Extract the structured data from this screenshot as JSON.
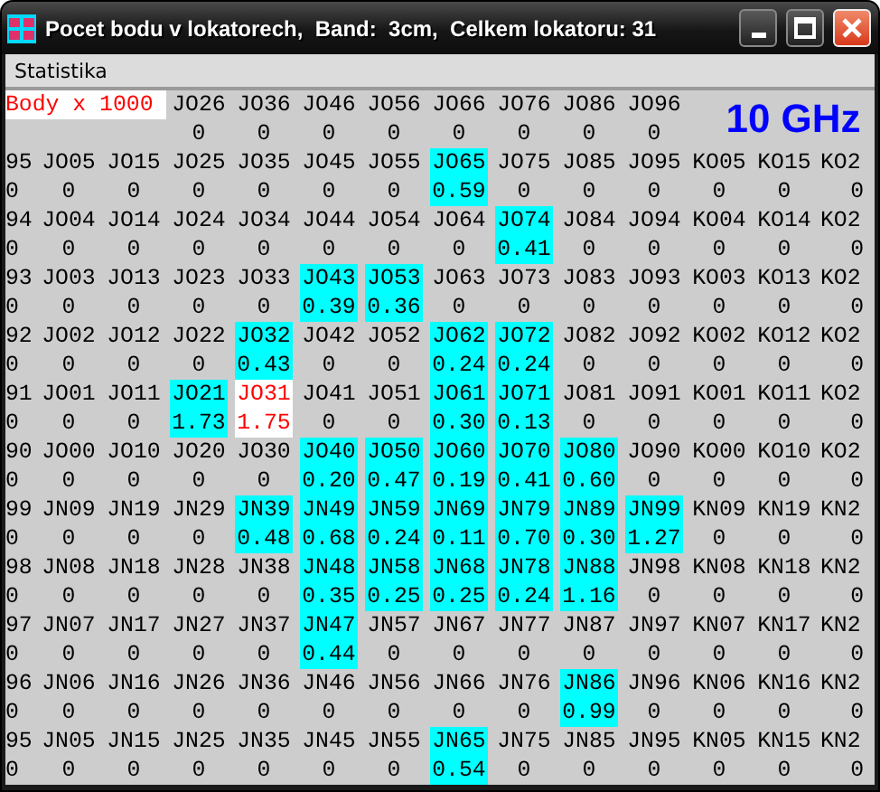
{
  "window": {
    "title": "Pocet bodu v lokatorech,  Band:  3cm,  Celkem lokatoru: 31"
  },
  "menu": [
    {
      "label": "Statistika"
    }
  ],
  "header": {
    "legend": "Body x 1000",
    "band_label": "10 GHz",
    "cells": [
      {
        "loc": "JO26",
        "pts": "0"
      },
      {
        "loc": "JO36",
        "pts": "0"
      },
      {
        "loc": "JO46",
        "pts": "0"
      },
      {
        "loc": "JO56",
        "pts": "0"
      },
      {
        "loc": "JO66",
        "pts": "0"
      },
      {
        "loc": "JO76",
        "pts": "0"
      },
      {
        "loc": "JO86",
        "pts": "0"
      },
      {
        "loc": "JO96",
        "pts": "0"
      }
    ]
  },
  "rows": [
    {
      "cells": [
        {
          "loc": "95",
          "pts": "0",
          "kind": "none"
        },
        {
          "loc": "JO05",
          "pts": "0",
          "kind": "none"
        },
        {
          "loc": "JO15",
          "pts": "0",
          "kind": "none"
        },
        {
          "loc": "JO25",
          "pts": "0",
          "kind": "none"
        },
        {
          "loc": "JO35",
          "pts": "0",
          "kind": "none"
        },
        {
          "loc": "JO45",
          "pts": "0",
          "kind": "none"
        },
        {
          "loc": "JO55",
          "pts": "0",
          "kind": "none"
        },
        {
          "loc": "JO65",
          "pts": "0.59",
          "kind": "worked"
        },
        {
          "loc": "JO75",
          "pts": "0",
          "kind": "none"
        },
        {
          "loc": "JO85",
          "pts": "0",
          "kind": "none"
        },
        {
          "loc": "JO95",
          "pts": "0",
          "kind": "none"
        },
        {
          "loc": "KO05",
          "pts": "0",
          "kind": "none"
        },
        {
          "loc": "KO15",
          "pts": "0",
          "kind": "none"
        },
        {
          "loc": "KO2",
          "pts": "0",
          "kind": "none"
        }
      ]
    },
    {
      "cells": [
        {
          "loc": "94",
          "pts": "0",
          "kind": "none"
        },
        {
          "loc": "JO04",
          "pts": "0",
          "kind": "none"
        },
        {
          "loc": "JO14",
          "pts": "0",
          "kind": "none"
        },
        {
          "loc": "JO24",
          "pts": "0",
          "kind": "none"
        },
        {
          "loc": "JO34",
          "pts": "0",
          "kind": "none"
        },
        {
          "loc": "JO44",
          "pts": "0",
          "kind": "none"
        },
        {
          "loc": "JO54",
          "pts": "0",
          "kind": "none"
        },
        {
          "loc": "JO64",
          "pts": "0",
          "kind": "none"
        },
        {
          "loc": "JO74",
          "pts": "0.41",
          "kind": "worked"
        },
        {
          "loc": "JO84",
          "pts": "0",
          "kind": "none"
        },
        {
          "loc": "JO94",
          "pts": "0",
          "kind": "none"
        },
        {
          "loc": "KO04",
          "pts": "0",
          "kind": "none"
        },
        {
          "loc": "KO14",
          "pts": "0",
          "kind": "none"
        },
        {
          "loc": "KO2",
          "pts": "0",
          "kind": "none"
        }
      ]
    },
    {
      "cells": [
        {
          "loc": "93",
          "pts": "0",
          "kind": "none"
        },
        {
          "loc": "JO03",
          "pts": "0",
          "kind": "none"
        },
        {
          "loc": "JO13",
          "pts": "0",
          "kind": "none"
        },
        {
          "loc": "JO23",
          "pts": "0",
          "kind": "none"
        },
        {
          "loc": "JO33",
          "pts": "0",
          "kind": "none"
        },
        {
          "loc": "JO43",
          "pts": "0.39",
          "kind": "worked"
        },
        {
          "loc": "JO53",
          "pts": "0.36",
          "kind": "worked"
        },
        {
          "loc": "JO63",
          "pts": "0",
          "kind": "none"
        },
        {
          "loc": "JO73",
          "pts": "0",
          "kind": "none"
        },
        {
          "loc": "JO83",
          "pts": "0",
          "kind": "none"
        },
        {
          "loc": "JO93",
          "pts": "0",
          "kind": "none"
        },
        {
          "loc": "KO03",
          "pts": "0",
          "kind": "none"
        },
        {
          "loc": "KO13",
          "pts": "0",
          "kind": "none"
        },
        {
          "loc": "KO2",
          "pts": "0",
          "kind": "none"
        }
      ]
    },
    {
      "cells": [
        {
          "loc": "92",
          "pts": "0",
          "kind": "none"
        },
        {
          "loc": "JO02",
          "pts": "0",
          "kind": "none"
        },
        {
          "loc": "JO12",
          "pts": "0",
          "kind": "none"
        },
        {
          "loc": "JO22",
          "pts": "0",
          "kind": "none"
        },
        {
          "loc": "JO32",
          "pts": "0.43",
          "kind": "worked"
        },
        {
          "loc": "JO42",
          "pts": "0",
          "kind": "none"
        },
        {
          "loc": "JO52",
          "pts": "0",
          "kind": "none"
        },
        {
          "loc": "JO62",
          "pts": "0.24",
          "kind": "worked"
        },
        {
          "loc": "JO72",
          "pts": "0.24",
          "kind": "worked"
        },
        {
          "loc": "JO82",
          "pts": "0",
          "kind": "none"
        },
        {
          "loc": "JO92",
          "pts": "0",
          "kind": "none"
        },
        {
          "loc": "KO02",
          "pts": "0",
          "kind": "none"
        },
        {
          "loc": "KO12",
          "pts": "0",
          "kind": "none"
        },
        {
          "loc": "KO2",
          "pts": "0",
          "kind": "none"
        }
      ]
    },
    {
      "cells": [
        {
          "loc": "91",
          "pts": "0",
          "kind": "none"
        },
        {
          "loc": "JO01",
          "pts": "0",
          "kind": "none"
        },
        {
          "loc": "JO11",
          "pts": "0",
          "kind": "none"
        },
        {
          "loc": "JO21",
          "pts": "1.73",
          "kind": "worked"
        },
        {
          "loc": "JO31",
          "pts": "1.75",
          "kind": "home"
        },
        {
          "loc": "JO41",
          "pts": "0",
          "kind": "none"
        },
        {
          "loc": "JO51",
          "pts": "0",
          "kind": "none"
        },
        {
          "loc": "JO61",
          "pts": "0.30",
          "kind": "worked"
        },
        {
          "loc": "JO71",
          "pts": "0.13",
          "kind": "worked"
        },
        {
          "loc": "JO81",
          "pts": "0",
          "kind": "none"
        },
        {
          "loc": "JO91",
          "pts": "0",
          "kind": "none"
        },
        {
          "loc": "KO01",
          "pts": "0",
          "kind": "none"
        },
        {
          "loc": "KO11",
          "pts": "0",
          "kind": "none"
        },
        {
          "loc": "KO2",
          "pts": "0",
          "kind": "none"
        }
      ]
    },
    {
      "cells": [
        {
          "loc": "90",
          "pts": "0",
          "kind": "none"
        },
        {
          "loc": "JO00",
          "pts": "0",
          "kind": "none"
        },
        {
          "loc": "JO10",
          "pts": "0",
          "kind": "none"
        },
        {
          "loc": "JO20",
          "pts": "0",
          "kind": "none"
        },
        {
          "loc": "JO30",
          "pts": "0",
          "kind": "none"
        },
        {
          "loc": "JO40",
          "pts": "0.20",
          "kind": "worked"
        },
        {
          "loc": "JO50",
          "pts": "0.47",
          "kind": "worked"
        },
        {
          "loc": "JO60",
          "pts": "0.19",
          "kind": "worked"
        },
        {
          "loc": "JO70",
          "pts": "0.41",
          "kind": "worked"
        },
        {
          "loc": "JO80",
          "pts": "0.60",
          "kind": "worked"
        },
        {
          "loc": "JO90",
          "pts": "0",
          "kind": "none"
        },
        {
          "loc": "KO00",
          "pts": "0",
          "kind": "none"
        },
        {
          "loc": "KO10",
          "pts": "0",
          "kind": "none"
        },
        {
          "loc": "KO2",
          "pts": "0",
          "kind": "none"
        }
      ]
    },
    {
      "cells": [
        {
          "loc": "99",
          "pts": "0",
          "kind": "none"
        },
        {
          "loc": "JN09",
          "pts": "0",
          "kind": "none"
        },
        {
          "loc": "JN19",
          "pts": "0",
          "kind": "none"
        },
        {
          "loc": "JN29",
          "pts": "0",
          "kind": "none"
        },
        {
          "loc": "JN39",
          "pts": "0.48",
          "kind": "worked"
        },
        {
          "loc": "JN49",
          "pts": "0.68",
          "kind": "worked"
        },
        {
          "loc": "JN59",
          "pts": "0.24",
          "kind": "worked"
        },
        {
          "loc": "JN69",
          "pts": "0.11",
          "kind": "worked"
        },
        {
          "loc": "JN79",
          "pts": "0.70",
          "kind": "worked"
        },
        {
          "loc": "JN89",
          "pts": "0.30",
          "kind": "worked"
        },
        {
          "loc": "JN99",
          "pts": "1.27",
          "kind": "worked"
        },
        {
          "loc": "KN09",
          "pts": "0",
          "kind": "none"
        },
        {
          "loc": "KN19",
          "pts": "0",
          "kind": "none"
        },
        {
          "loc": "KN2",
          "pts": "0",
          "kind": "none"
        }
      ]
    },
    {
      "cells": [
        {
          "loc": "98",
          "pts": "0",
          "kind": "none"
        },
        {
          "loc": "JN08",
          "pts": "0",
          "kind": "none"
        },
        {
          "loc": "JN18",
          "pts": "0",
          "kind": "none"
        },
        {
          "loc": "JN28",
          "pts": "0",
          "kind": "none"
        },
        {
          "loc": "JN38",
          "pts": "0",
          "kind": "none"
        },
        {
          "loc": "JN48",
          "pts": "0.35",
          "kind": "worked"
        },
        {
          "loc": "JN58",
          "pts": "0.25",
          "kind": "worked"
        },
        {
          "loc": "JN68",
          "pts": "0.25",
          "kind": "worked"
        },
        {
          "loc": "JN78",
          "pts": "0.24",
          "kind": "worked"
        },
        {
          "loc": "JN88",
          "pts": "1.16",
          "kind": "worked"
        },
        {
          "loc": "JN98",
          "pts": "0",
          "kind": "none"
        },
        {
          "loc": "KN08",
          "pts": "0",
          "kind": "none"
        },
        {
          "loc": "KN18",
          "pts": "0",
          "kind": "none"
        },
        {
          "loc": "KN2",
          "pts": "0",
          "kind": "none"
        }
      ]
    },
    {
      "cells": [
        {
          "loc": "97",
          "pts": "0",
          "kind": "none"
        },
        {
          "loc": "JN07",
          "pts": "0",
          "kind": "none"
        },
        {
          "loc": "JN17",
          "pts": "0",
          "kind": "none"
        },
        {
          "loc": "JN27",
          "pts": "0",
          "kind": "none"
        },
        {
          "loc": "JN37",
          "pts": "0",
          "kind": "none"
        },
        {
          "loc": "JN47",
          "pts": "0.44",
          "kind": "worked"
        },
        {
          "loc": "JN57",
          "pts": "0",
          "kind": "none"
        },
        {
          "loc": "JN67",
          "pts": "0",
          "kind": "none"
        },
        {
          "loc": "JN77",
          "pts": "0",
          "kind": "none"
        },
        {
          "loc": "JN87",
          "pts": "0",
          "kind": "none"
        },
        {
          "loc": "JN97",
          "pts": "0",
          "kind": "none"
        },
        {
          "loc": "KN07",
          "pts": "0",
          "kind": "none"
        },
        {
          "loc": "KN17",
          "pts": "0",
          "kind": "none"
        },
        {
          "loc": "KN2",
          "pts": "0",
          "kind": "none"
        }
      ]
    },
    {
      "cells": [
        {
          "loc": "96",
          "pts": "0",
          "kind": "none"
        },
        {
          "loc": "JN06",
          "pts": "0",
          "kind": "none"
        },
        {
          "loc": "JN16",
          "pts": "0",
          "kind": "none"
        },
        {
          "loc": "JN26",
          "pts": "0",
          "kind": "none"
        },
        {
          "loc": "JN36",
          "pts": "0",
          "kind": "none"
        },
        {
          "loc": "JN46",
          "pts": "0",
          "kind": "none"
        },
        {
          "loc": "JN56",
          "pts": "0",
          "kind": "none"
        },
        {
          "loc": "JN66",
          "pts": "0",
          "kind": "none"
        },
        {
          "loc": "JN76",
          "pts": "0",
          "kind": "none"
        },
        {
          "loc": "JN86",
          "pts": "0.99",
          "kind": "worked"
        },
        {
          "loc": "JN96",
          "pts": "0",
          "kind": "none"
        },
        {
          "loc": "KN06",
          "pts": "0",
          "kind": "none"
        },
        {
          "loc": "KN16",
          "pts": "0",
          "kind": "none"
        },
        {
          "loc": "KN2",
          "pts": "0",
          "kind": "none"
        }
      ]
    },
    {
      "cells": [
        {
          "loc": "95",
          "pts": "0",
          "kind": "none"
        },
        {
          "loc": "JN05",
          "pts": "0",
          "kind": "none"
        },
        {
          "loc": "JN15",
          "pts": "0",
          "kind": "none"
        },
        {
          "loc": "JN25",
          "pts": "0",
          "kind": "none"
        },
        {
          "loc": "JN35",
          "pts": "0",
          "kind": "none"
        },
        {
          "loc": "JN45",
          "pts": "0",
          "kind": "none"
        },
        {
          "loc": "JN55",
          "pts": "0",
          "kind": "none"
        },
        {
          "loc": "JN65",
          "pts": "0.54",
          "kind": "worked"
        },
        {
          "loc": "JN75",
          "pts": "0",
          "kind": "none"
        },
        {
          "loc": "JN85",
          "pts": "0",
          "kind": "none"
        },
        {
          "loc": "JN95",
          "pts": "0",
          "kind": "none"
        },
        {
          "loc": "KN05",
          "pts": "0",
          "kind": "none"
        },
        {
          "loc": "KN15",
          "pts": "0",
          "kind": "none"
        },
        {
          "loc": "KN2",
          "pts": "0",
          "kind": "none"
        }
      ]
    }
  ]
}
